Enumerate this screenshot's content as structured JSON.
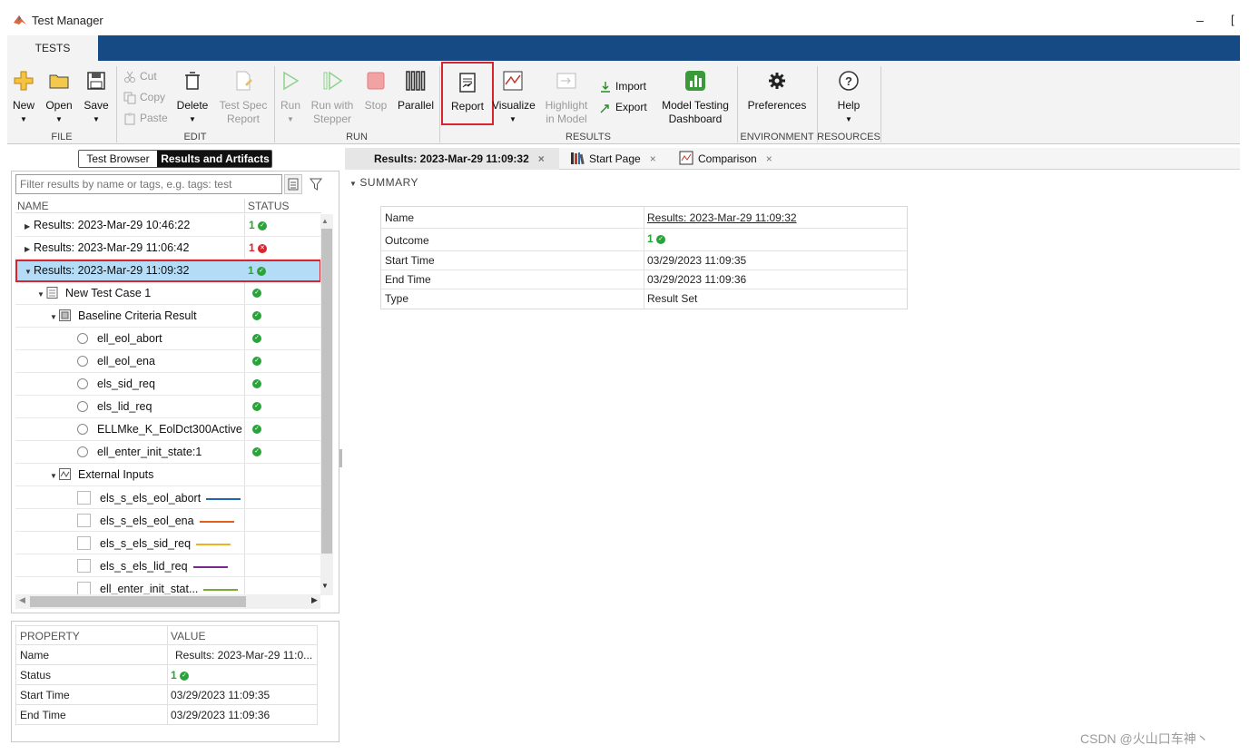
{
  "window": {
    "title": "Test Manager",
    "minimize": "–",
    "maximize": "[",
    "accent": "#164a84"
  },
  "ribbon_tab": "TESTS",
  "toolbar": {
    "new": "New",
    "open": "Open",
    "save": "Save",
    "cut": "Cut",
    "copy": "Copy",
    "paste": "Paste",
    "delete": "Delete",
    "test_spec_l1": "Test Spec",
    "test_spec_l2": "Report",
    "run": "Run",
    "run_with_l1": "Run with",
    "run_with_l2": "Stepper",
    "stop": "Stop",
    "parallel": "Parallel",
    "report": "Report",
    "visualize": "Visualize",
    "highlight_l1": "Highlight",
    "highlight_l2": "in Model",
    "import": "Import",
    "export": "Export",
    "mtd_l1": "Model Testing",
    "mtd_l2": "Dashboard",
    "preferences": "Preferences",
    "help": "Help",
    "sections": {
      "file": "FILE",
      "edit": "EDIT",
      "run": "RUN",
      "results": "RESULTS",
      "environment": "ENVIRONMENT",
      "resources": "RESOURCES"
    }
  },
  "left": {
    "toggle_browser": "Test Browser",
    "toggle_results": "Results and Artifacts",
    "filter_placeholder": "Filter results by name or tags, e.g. tags: test",
    "col_name": "NAME",
    "col_status": "STATUS",
    "rows": [
      {
        "label": "Results: 2023-Mar-29 10:46:22",
        "count": "1",
        "status": "pass"
      },
      {
        "label": "Results: 2023-Mar-29 11:06:42",
        "count": "1",
        "status": "fail"
      },
      {
        "label": "Results: 2023-Mar-29 11:09:32",
        "count": "1",
        "status": "pass"
      },
      {
        "label": "New Test Case 1"
      },
      {
        "label": "Baseline Criteria Result"
      },
      {
        "label": "ell_eol_abort"
      },
      {
        "label": "ell_eol_ena"
      },
      {
        "label": "els_sid_req"
      },
      {
        "label": "els_lid_req"
      },
      {
        "label": "ELLMke_K_EolDct300Active"
      },
      {
        "label": "ell_enter_init_state:1"
      },
      {
        "label": "External Inputs"
      },
      {
        "label": "els_s_els_eol_abort",
        "color": "#1f66b5"
      },
      {
        "label": "els_s_els_eol_ena",
        "color": "#e0601c"
      },
      {
        "label": "els_s_els_sid_req",
        "color": "#f0b21e"
      },
      {
        "label": "els_s_els_lid_req",
        "color": "#7a2a8c"
      },
      {
        "label": "ell_enter_init_stat...",
        "color": "#77ac30"
      }
    ]
  },
  "properties": {
    "col_property": "PROPERTY",
    "col_value": "VALUE",
    "rows": [
      {
        "key": "Name",
        "value": "Results: 2023-Mar-29 11:0..."
      },
      {
        "key": "Status",
        "value": "1"
      },
      {
        "key": "Start Time",
        "value": "03/29/2023 11:09:35"
      },
      {
        "key": "End Time",
        "value": "03/29/2023 11:09:36"
      }
    ]
  },
  "doc_tabs": [
    {
      "label": "Results: 2023-Mar-29 11:09:32",
      "close": "×"
    },
    {
      "label": "Start Page",
      "close": "×"
    },
    {
      "label": "Comparison",
      "close": "×"
    }
  ],
  "summary": {
    "header": "SUMMARY",
    "rows": [
      {
        "key": "Name",
        "value": "Results: 2023-Mar-29 11:09:32"
      },
      {
        "key": "Outcome",
        "value": "1"
      },
      {
        "key": "Start Time",
        "value": "03/29/2023 11:09:35"
      },
      {
        "key": "End Time",
        "value": "03/29/2023 11:09:36"
      },
      {
        "key": "Type",
        "value": "Result Set"
      }
    ]
  },
  "watermark": "CSDN @火山口车神丶"
}
